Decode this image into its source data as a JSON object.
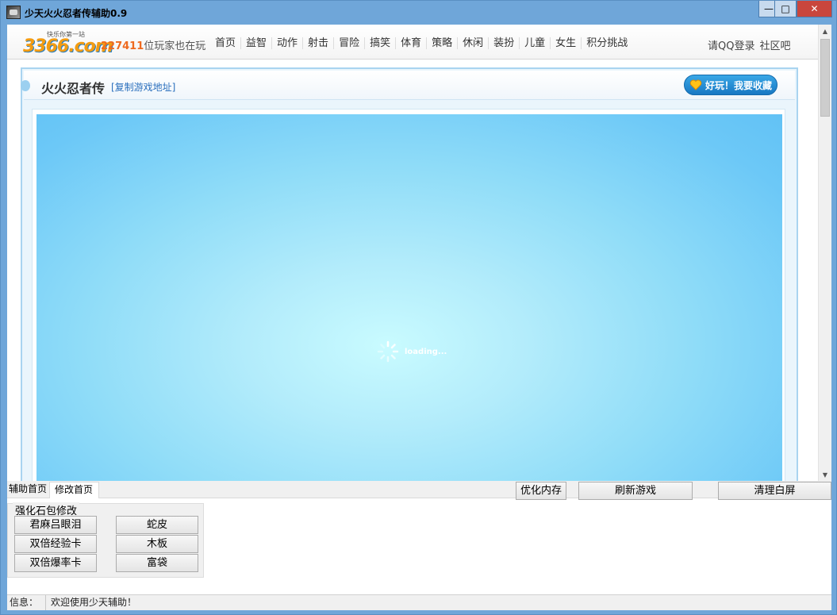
{
  "window": {
    "title": "少天火火忍者传辅助0.9",
    "minimize": "—",
    "maximize": "□",
    "close": "✕"
  },
  "site": {
    "logo_text": "3366.com",
    "logo_tagline": "快乐你第一站",
    "player_count": "227411",
    "player_suffix": "位玩家也在玩",
    "nav": [
      "首页",
      "益智",
      "动作",
      "射击",
      "冒险",
      "搞笑",
      "体育",
      "策略",
      "休闲",
      "装扮",
      "儿童",
      "女生",
      "积分挑战"
    ],
    "login": "请QQ登录",
    "community": "社区吧"
  },
  "game": {
    "title": "火火忍者传",
    "copy_link": "[复制游戏地址]",
    "fav_label": "好玩！我要收藏",
    "loading_text": "loading..."
  },
  "helper": {
    "tabs": [
      "辅助首页",
      "修改首页"
    ],
    "tools": {
      "optimize": "优化内存",
      "refresh": "刷新游戏",
      "clear": "清理白屏"
    },
    "group_title": "强化石包修改",
    "mods": [
      "君麻吕眼泪",
      "蛇皮",
      "双倍经验卡",
      "木板",
      "双倍爆率卡",
      "富袋"
    ]
  },
  "status": {
    "label": "信息：",
    "message": "欢迎使用少天辅助！"
  },
  "colors": {
    "title_bar": "#6fa6d9",
    "accent_orange": "#ee6a1f",
    "link_blue": "#2a6fbd",
    "close_red": "#c9463d"
  }
}
